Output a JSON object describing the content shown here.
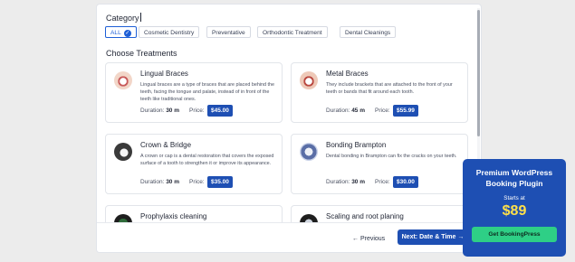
{
  "category": {
    "label": "Category",
    "chips": [
      {
        "label": "ALL",
        "active": true
      },
      {
        "label": "Cosmetic Dentistry",
        "active": false
      },
      {
        "label": "Preventative",
        "active": false
      },
      {
        "label": "Orthodontic Treatment",
        "active": false
      },
      {
        "label": "Dental Cleanings",
        "active": false
      }
    ]
  },
  "treatments": {
    "title": "Choose Treatments",
    "cards": [
      {
        "name": "Lingual Braces",
        "desc": "Lingual braces are a type of braces that are placed behind the teeth, facing the tongue and palate, instead of in front of the teeth like traditional ones.",
        "duration_label": "Duration:",
        "duration": "30 m",
        "price_label": "Price:",
        "price": "$45.00"
      },
      {
        "name": "Metal Braces",
        "desc": "They include brackets that are attached to the front of your teeth or bands that fit around each tooth.",
        "duration_label": "Duration:",
        "duration": "45 m",
        "price_label": "Price:",
        "price": "$55.99"
      },
      {
        "name": "Crown & Bridge",
        "desc": "A crown or cap is a dental restoration that covers the exposed surface of a tooth to strengthen it or improve its appearance.",
        "duration_label": "Duration:",
        "duration": "30 m",
        "price_label": "Price:",
        "price": "$35.00"
      },
      {
        "name": "Bonding Brampton",
        "desc": "Dental bonding in Brampton can fix the cracks on your teeth.",
        "duration_label": "Duration:",
        "duration": "30 m",
        "price_label": "Price:",
        "price": "$30.00"
      },
      {
        "name": "Prophylaxis cleaning"
      },
      {
        "name": "Scaling and root planing"
      }
    ]
  },
  "footer": {
    "previous": "← Previous",
    "next": "Next: Date & Time →"
  },
  "promo": {
    "title": "Premium WordPress Booking Plugin",
    "starts": "Starts at",
    "price": "$89",
    "button": "Get BookingPress"
  }
}
